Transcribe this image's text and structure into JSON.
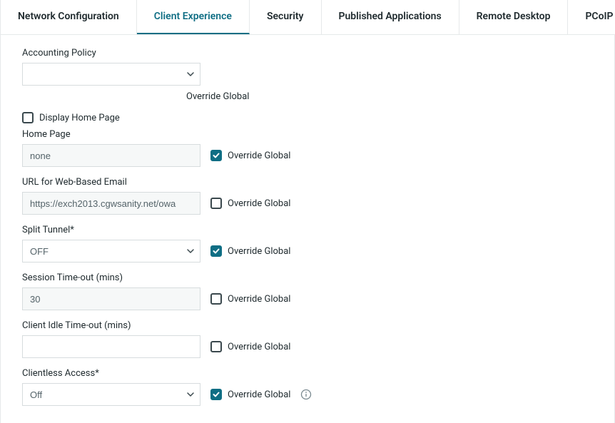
{
  "tabs": [
    {
      "label": "Network Configuration"
    },
    {
      "label": "Client Experience"
    },
    {
      "label": "Security"
    },
    {
      "label": "Published Applications"
    },
    {
      "label": "Remote Desktop"
    },
    {
      "label": "PCoIP"
    }
  ],
  "override_label": "Override Global",
  "accounting_policy": {
    "label": "Accounting Policy",
    "value": ""
  },
  "display_home_page": {
    "label": "Display Home Page",
    "checked": false
  },
  "home_page": {
    "label": "Home Page",
    "value": "none",
    "override": true
  },
  "url_web_email": {
    "label": "URL for Web-Based Email",
    "value": "https://exch2013.cgwsanity.net/owa",
    "override": false
  },
  "split_tunnel": {
    "label": "Split Tunnel*",
    "value": "OFF",
    "override": true
  },
  "session_timeout": {
    "label": "Session Time-out (mins)",
    "value": "30",
    "override": false
  },
  "client_idle_timeout": {
    "label": "Client Idle Time-out (mins)",
    "value": "",
    "override": false
  },
  "clientless_access": {
    "label": "Clientless Access*",
    "value": "Off",
    "override": true
  }
}
